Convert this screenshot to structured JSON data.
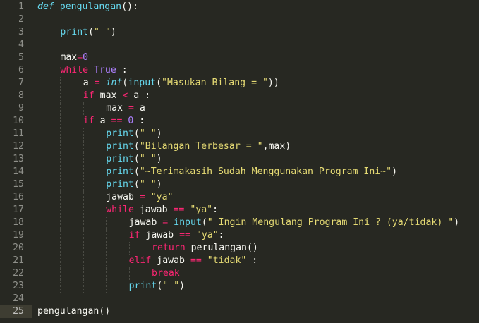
{
  "editor": {
    "theme_colors": {
      "background": "#272822",
      "keyword": "#f92672",
      "function": "#66d9ef",
      "string": "#e6db74",
      "number": "#ae81ff",
      "text": "#f8f8f2",
      "line_number": "#8f908a"
    },
    "current_line": 25,
    "lines": [
      {
        "n": "1",
        "indent": 0,
        "tokens": [
          [
            "bi",
            "def"
          ],
          [
            "var",
            " "
          ],
          [
            "fn",
            "pengulangan"
          ],
          [
            "var",
            "():"
          ]
        ]
      },
      {
        "n": "2",
        "indent": 0,
        "tokens": []
      },
      {
        "n": "3",
        "indent": 1,
        "tokens": [
          [
            "fn",
            "print"
          ],
          [
            "var",
            "("
          ],
          [
            "str",
            "\" \""
          ],
          [
            "var",
            ")"
          ]
        ]
      },
      {
        "n": "4",
        "indent": 0,
        "tokens": []
      },
      {
        "n": "5",
        "indent": 1,
        "tokens": [
          [
            "var",
            "max"
          ],
          [
            "kw",
            "="
          ],
          [
            "num",
            "0"
          ]
        ]
      },
      {
        "n": "6",
        "indent": 1,
        "tokens": [
          [
            "kw",
            "while"
          ],
          [
            "var",
            " "
          ],
          [
            "num",
            "True"
          ],
          [
            "var",
            " :"
          ]
        ]
      },
      {
        "n": "7",
        "indent": 2,
        "tokens": [
          [
            "var",
            "a "
          ],
          [
            "kw",
            "="
          ],
          [
            "var",
            " "
          ],
          [
            "bi",
            "int"
          ],
          [
            "var",
            "("
          ],
          [
            "fn",
            "input"
          ],
          [
            "var",
            "("
          ],
          [
            "str",
            "\"Masukan Bilang = \""
          ],
          [
            "var",
            "))"
          ]
        ]
      },
      {
        "n": "8",
        "indent": 2,
        "tokens": [
          [
            "kw",
            "if"
          ],
          [
            "var",
            " max "
          ],
          [
            "kw",
            "<"
          ],
          [
            "var",
            " a :"
          ]
        ]
      },
      {
        "n": "9",
        "indent": 3,
        "tokens": [
          [
            "var",
            "max "
          ],
          [
            "kw",
            "="
          ],
          [
            "var",
            " a"
          ]
        ]
      },
      {
        "n": "10",
        "indent": 2,
        "tokens": [
          [
            "kw",
            "if"
          ],
          [
            "var",
            " a "
          ],
          [
            "kw",
            "=="
          ],
          [
            "var",
            " "
          ],
          [
            "num",
            "0"
          ],
          [
            "var",
            " :"
          ]
        ]
      },
      {
        "n": "11",
        "indent": 3,
        "tokens": [
          [
            "fn",
            "print"
          ],
          [
            "var",
            "("
          ],
          [
            "str",
            "\" \""
          ],
          [
            "var",
            ")"
          ]
        ]
      },
      {
        "n": "12",
        "indent": 3,
        "tokens": [
          [
            "fn",
            "print"
          ],
          [
            "var",
            "("
          ],
          [
            "str",
            "\"Bilangan Terbesar = \""
          ],
          [
            "var",
            ",max)"
          ]
        ]
      },
      {
        "n": "13",
        "indent": 3,
        "tokens": [
          [
            "fn",
            "print"
          ],
          [
            "var",
            "("
          ],
          [
            "str",
            "\" \""
          ],
          [
            "var",
            ")"
          ]
        ]
      },
      {
        "n": "14",
        "indent": 3,
        "tokens": [
          [
            "fn",
            "print"
          ],
          [
            "var",
            "("
          ],
          [
            "str",
            "\"~Terimakasih Sudah Menggunakan Program Ini~\""
          ],
          [
            "var",
            ")"
          ]
        ]
      },
      {
        "n": "15",
        "indent": 3,
        "tokens": [
          [
            "fn",
            "print"
          ],
          [
            "var",
            "("
          ],
          [
            "str",
            "\" \""
          ],
          [
            "var",
            ")"
          ]
        ]
      },
      {
        "n": "16",
        "indent": 3,
        "tokens": [
          [
            "var",
            "jawab "
          ],
          [
            "kw",
            "="
          ],
          [
            "var",
            " "
          ],
          [
            "str",
            "\"ya\""
          ]
        ]
      },
      {
        "n": "17",
        "indent": 3,
        "tokens": [
          [
            "kw",
            "while"
          ],
          [
            "var",
            " jawab "
          ],
          [
            "kw",
            "=="
          ],
          [
            "var",
            " "
          ],
          [
            "str",
            "\"ya\""
          ],
          [
            "var",
            ":"
          ]
        ]
      },
      {
        "n": "18",
        "indent": 4,
        "tokens": [
          [
            "var",
            "jawab "
          ],
          [
            "kw",
            "="
          ],
          [
            "var",
            " "
          ],
          [
            "fn",
            "input"
          ],
          [
            "var",
            "("
          ],
          [
            "str",
            "\" Ingin Mengulang Program Ini ? (ya/tidak) \""
          ],
          [
            "var",
            ")"
          ]
        ]
      },
      {
        "n": "19",
        "indent": 4,
        "tokens": [
          [
            "kw",
            "if"
          ],
          [
            "var",
            " jawab "
          ],
          [
            "kw",
            "=="
          ],
          [
            "var",
            " "
          ],
          [
            "str",
            "\"ya\""
          ],
          [
            "var",
            ":"
          ]
        ]
      },
      {
        "n": "20",
        "indent": 5,
        "tokens": [
          [
            "kw",
            "return"
          ],
          [
            "var",
            " perulangan()"
          ]
        ]
      },
      {
        "n": "21",
        "indent": 4,
        "tokens": [
          [
            "kw",
            "elif"
          ],
          [
            "var",
            " jawab "
          ],
          [
            "kw",
            "=="
          ],
          [
            "var",
            " "
          ],
          [
            "str",
            "\"tidak\""
          ],
          [
            "var",
            " :"
          ]
        ]
      },
      {
        "n": "22",
        "indent": 5,
        "tokens": [
          [
            "kw",
            "break"
          ]
        ]
      },
      {
        "n": "23",
        "indent": 4,
        "tokens": [
          [
            "fn",
            "print"
          ],
          [
            "var",
            "("
          ],
          [
            "str",
            "\" \""
          ],
          [
            "var",
            ")"
          ]
        ]
      },
      {
        "n": "24",
        "indent": 0,
        "tokens": []
      },
      {
        "n": "25",
        "indent": 0,
        "tokens": [
          [
            "var",
            "pengulangan()"
          ]
        ]
      }
    ]
  }
}
